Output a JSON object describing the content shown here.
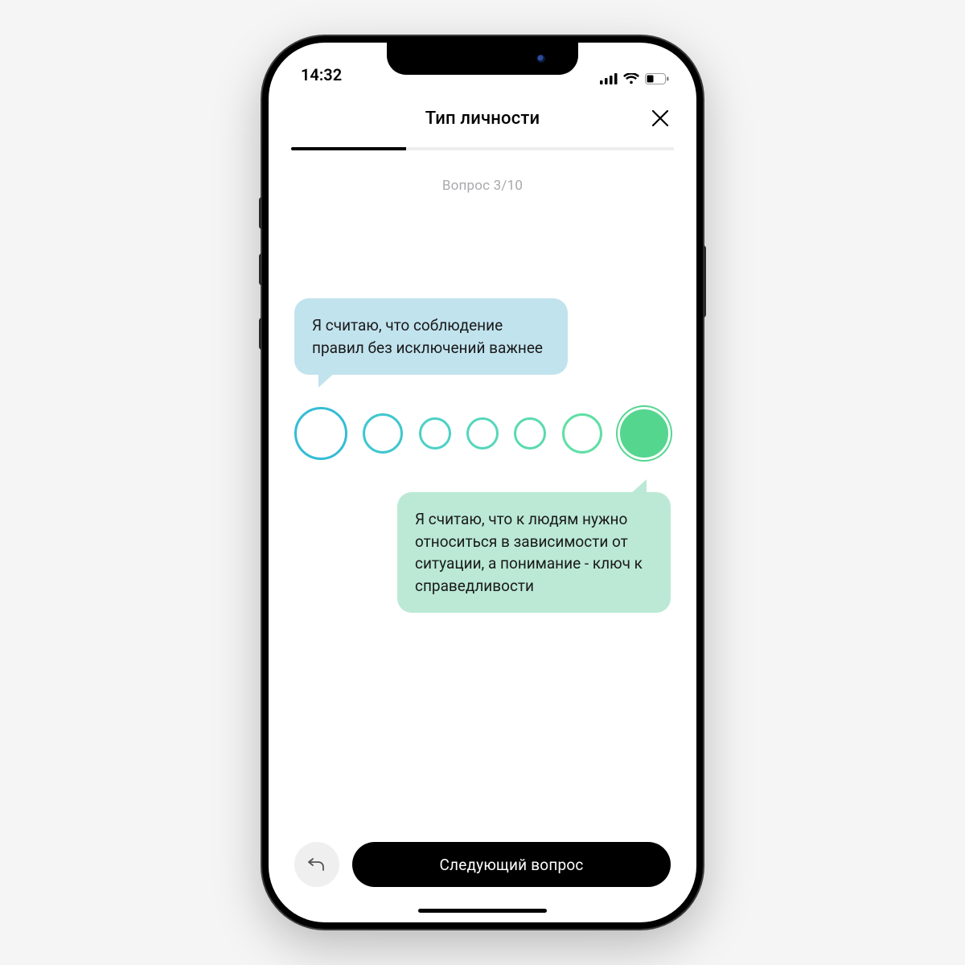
{
  "status": {
    "time": "14:32"
  },
  "header": {
    "title": "Тип личности"
  },
  "progress": {
    "percent": 30
  },
  "counter": {
    "text": "Вопрос 3/10"
  },
  "question": {
    "left": "Я считаю, что соблюдение правил без исключений важнее",
    "right": "Я считаю, что к людям нужно относиться в зависимости от ситуации, а понимание - ключ к справедливости"
  },
  "scale": {
    "selected_index": 6
  },
  "footer": {
    "next_label": "Следующий вопрос"
  }
}
